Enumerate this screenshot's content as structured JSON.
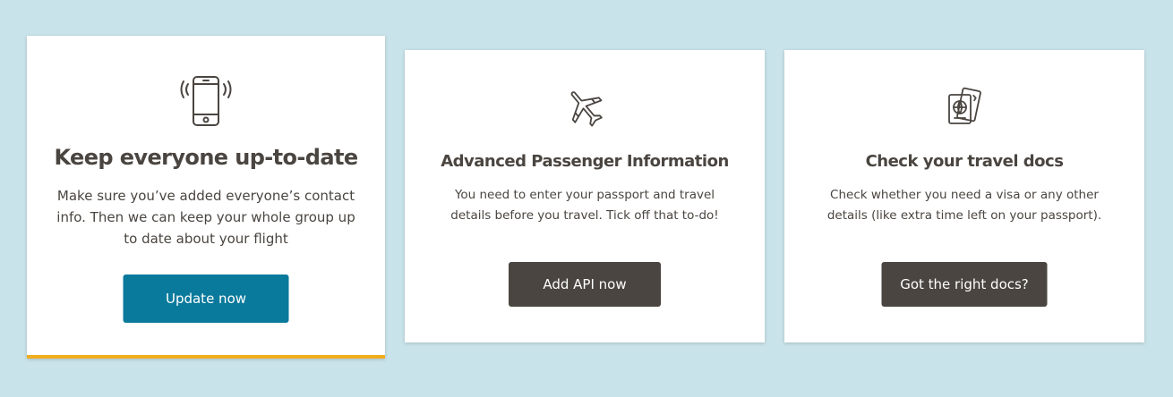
{
  "cards": [
    {
      "icon": "phone-vibrating-icon",
      "title": "Keep everyone up-to-date",
      "description": "Make sure you’ve added everyone’s contact info. Then we can keep your whole group up to date about your flight",
      "button_label": "Update now"
    },
    {
      "icon": "airplane-icon",
      "title": "Advanced Passenger Information",
      "description": "You need to enter your passport and travel details before you travel. Tick off that to-do!",
      "button_label": "Add API now"
    },
    {
      "icon": "passport-icon",
      "title": "Check your travel docs",
      "description": "Check whether you need a visa or any other details (like extra time left on your passport).",
      "button_label": "Got the right docs?"
    }
  ],
  "colors": {
    "background": "#c9e3ea",
    "primary_button": "#0a7a9c",
    "secondary_button": "#4a4540",
    "highlight_border": "#f0ae1e",
    "text": "#4a4540"
  }
}
